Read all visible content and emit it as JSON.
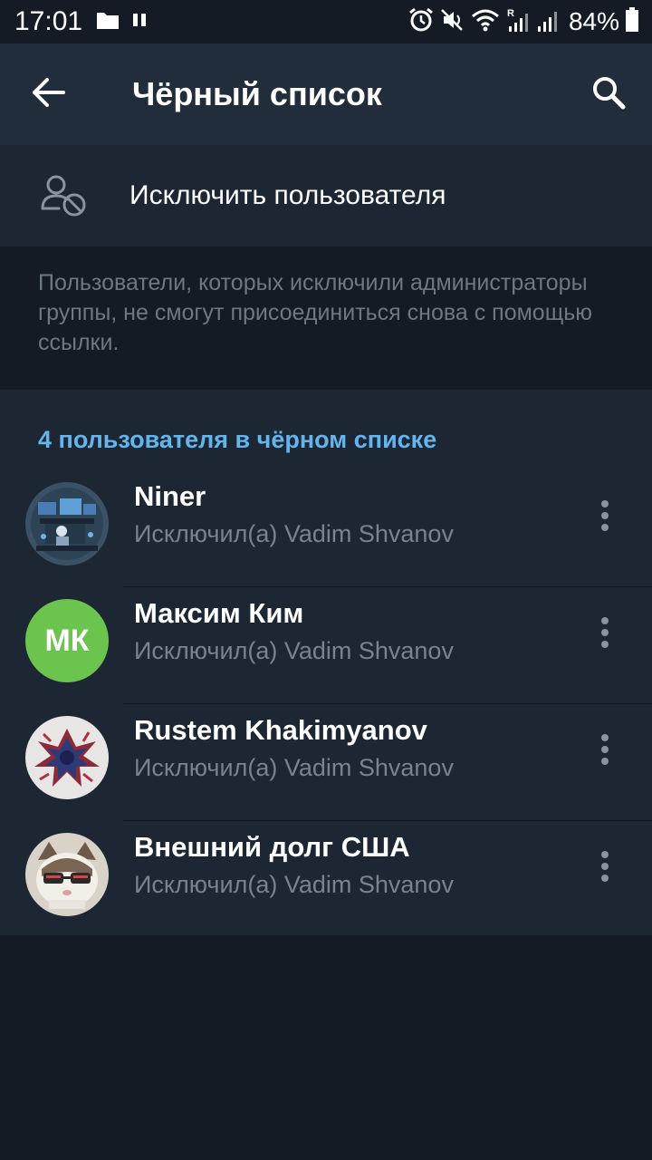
{
  "status_bar": {
    "time": "17:01",
    "battery_percent": "84%",
    "icons": [
      "folder-icon",
      "pause-icon",
      "alarm-icon",
      "mute-icon",
      "wifi-icon",
      "signal-r-icon",
      "signal-icon",
      "battery-icon"
    ]
  },
  "app_bar": {
    "title": "Чёрный список",
    "back_icon": "arrow-left-icon",
    "search_icon": "search-icon"
  },
  "ban_action": {
    "label": "Исключить пользователя",
    "icon": "user-block-icon"
  },
  "hint": {
    "text": "Пользователи, которых исключили администраторы группы, не смогут присоединиться снова с помощью ссылки."
  },
  "blacklist": {
    "header": "4 пользователя в чёрном списке",
    "users": [
      {
        "name": "Niner",
        "subtitle": "Исключил(а) Vadim Shvanov",
        "avatar": "photo-desk-illustration"
      },
      {
        "name": "Максим Ким",
        "subtitle": "Исключил(а) Vadim Shvanov",
        "avatar_initials": "МК",
        "avatar_color": "#6bc44d"
      },
      {
        "name": "Rustem Khakimyanov",
        "subtitle": "Исключил(а) Vadim Shvanov",
        "avatar": "photo-abstract-red-blue"
      },
      {
        "name": "Внешний долг США",
        "subtitle": "Исключил(а) Vadim Shvanov",
        "avatar": "photo-cat-with-glasses"
      }
    ]
  },
  "colors": {
    "app_bar": "#212d3b",
    "background": "#151b24",
    "section": "#1d2733",
    "accent_header": "#64b5ef",
    "subtitle": "#79838e",
    "hint": "#6d7883"
  }
}
